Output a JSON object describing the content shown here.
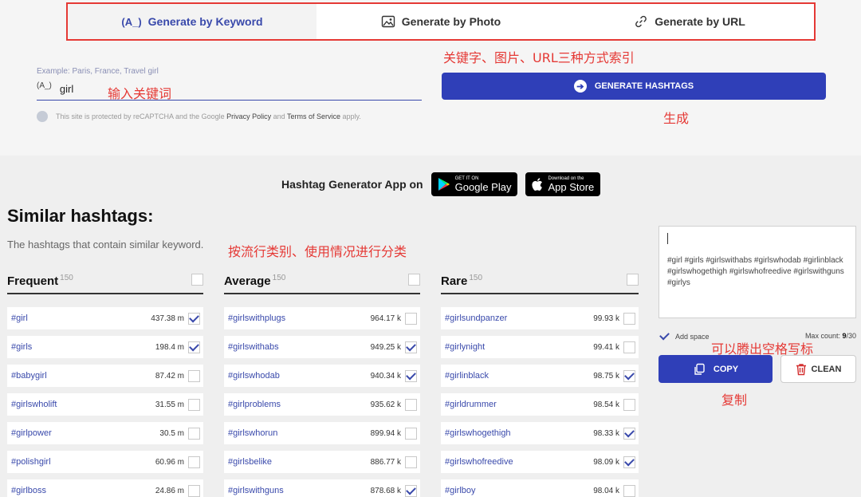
{
  "tabs": [
    {
      "icon": "(A_)",
      "label": "Generate by Keyword"
    },
    {
      "icon": "image-icon",
      "label": "Generate by Photo"
    },
    {
      "icon": "link-icon",
      "label": "Generate by URL"
    }
  ],
  "annotations": {
    "tabs": "关键字、图片、URL三种方式索引",
    "input": "输入关键词",
    "generate": "生成",
    "categories": "按流行类别、使用情况进行分类",
    "space": "可以腾出空格写标",
    "copy": "复制"
  },
  "search": {
    "example": "Example: Paris, France, Travel girl",
    "icon": "(A_)",
    "value": "girl"
  },
  "recaptcha": {
    "pre": "This site is protected by reCAPTCHA and the Google ",
    "privacy": "Privacy Policy",
    "mid": " and ",
    "terms": "Terms of Service",
    "post": " apply."
  },
  "generate_button": "GENERATE HASHTAGS",
  "app": {
    "label": "Hashtag Generator App on",
    "google_small": "GET IT ON",
    "google_big": "Google Play",
    "apple_small": "Download on the",
    "apple_big": "App Store"
  },
  "similar": {
    "title": "Similar hashtags:",
    "subtitle": "The hashtags that contain similar keyword."
  },
  "columns": [
    {
      "title": "Frequent",
      "count": "150",
      "rows": [
        {
          "tag": "#girl",
          "num": "437.38 m",
          "checked": true
        },
        {
          "tag": "#girls",
          "num": "198.4 m",
          "checked": true
        },
        {
          "tag": "#babygirl",
          "num": "87.42 m",
          "checked": false
        },
        {
          "tag": "#girlswholift",
          "num": "31.55 m",
          "checked": false
        },
        {
          "tag": "#girlpower",
          "num": "30.5 m",
          "checked": false
        },
        {
          "tag": "#polishgirl",
          "num": "60.96 m",
          "checked": false
        },
        {
          "tag": "#girlboss",
          "num": "24.86 m",
          "checked": false
        }
      ]
    },
    {
      "title": "Average",
      "count": "150",
      "rows": [
        {
          "tag": "#girlswithplugs",
          "num": "964.17 k",
          "checked": false
        },
        {
          "tag": "#girlswithabs",
          "num": "949.25 k",
          "checked": true
        },
        {
          "tag": "#girlswhodab",
          "num": "940.34 k",
          "checked": true
        },
        {
          "tag": "#girlproblems",
          "num": "935.62 k",
          "checked": false
        },
        {
          "tag": "#girlswhorun",
          "num": "899.94 k",
          "checked": false
        },
        {
          "tag": "#girlsbelike",
          "num": "886.77 k",
          "checked": false
        },
        {
          "tag": "#girlswithguns",
          "num": "878.68 k",
          "checked": true
        }
      ]
    },
    {
      "title": "Rare",
      "count": "150",
      "rows": [
        {
          "tag": "#girlsundpanzer",
          "num": "99.93 k",
          "checked": false
        },
        {
          "tag": "#girlynight",
          "num": "99.41 k",
          "checked": false
        },
        {
          "tag": "#girlinblack",
          "num": "98.75 k",
          "checked": true
        },
        {
          "tag": "#girldrummer",
          "num": "98.54 k",
          "checked": false
        },
        {
          "tag": "#girlswhogethigh",
          "num": "98.33 k",
          "checked": true
        },
        {
          "tag": "#girlswhofreedive",
          "num": "98.09 k",
          "checked": true
        },
        {
          "tag": "#girlboy",
          "num": "98.04 k",
          "checked": false
        }
      ]
    }
  ],
  "panel": {
    "text": "#girl #girls #girlswithabs #girlswhodab #girlinblack #girlswhogethigh #girlswhofreedive #girlswithguns #girlys",
    "add_space": "Add space",
    "max_label": "Max count: ",
    "max_value": "9",
    "max_total": "/30",
    "copy": "COPY",
    "clean": "CLEAN"
  },
  "colors": {
    "accent": "#2f3fb8",
    "annotation": "#e53935"
  }
}
